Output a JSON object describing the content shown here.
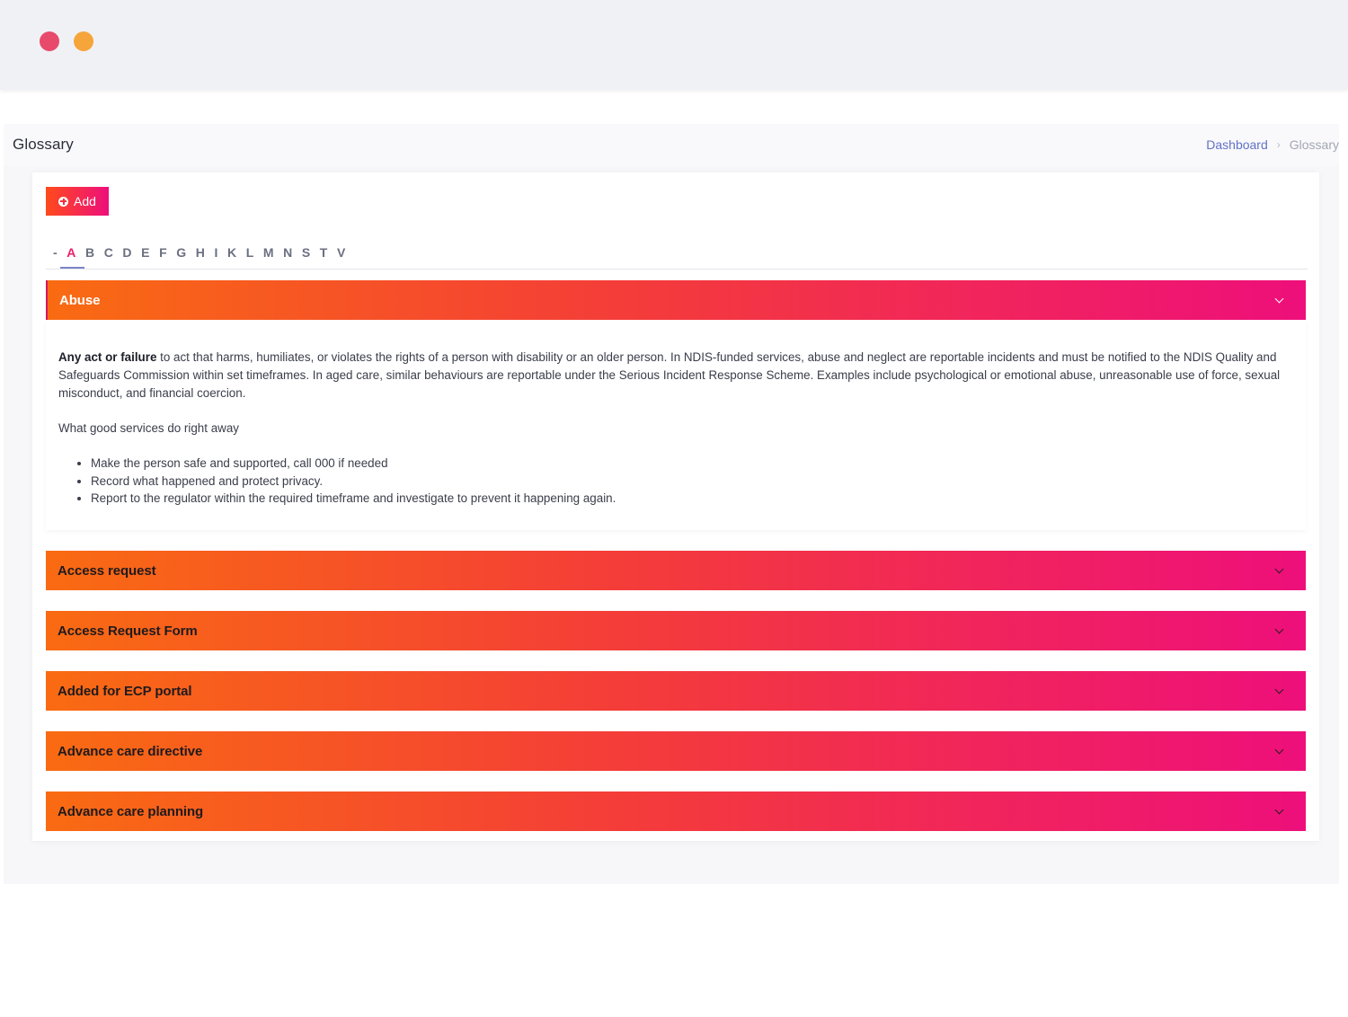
{
  "page": {
    "title": "Glossary",
    "breadcrumb": {
      "home": "Dashboard",
      "separator": "›",
      "current": "Glossary"
    }
  },
  "toolbar": {
    "add_label": "Add"
  },
  "letters": [
    "-",
    "A",
    "B",
    "C",
    "D",
    "E",
    "F",
    "G",
    "H",
    "I",
    "K",
    "L",
    "M",
    "N",
    "S",
    "T",
    "V"
  ],
  "active_letter": "A",
  "entries": [
    {
      "title": "Abuse",
      "expanded": true,
      "definition_bold": "Any act or failure",
      "definition_rest": " to act that harms, humiliates, or violates the rights of a person with disability or an older person. In NDIS-funded services, abuse and neglect are reportable incidents and must be notified to the NDIS Quality and Safeguards Commission within set timeframes. In aged care, similar behaviours are reportable under the Serious Incident Response Scheme. Examples include psychological or emotional abuse, unreasonable use of force, sexual misconduct, and financial coercion.",
      "subheading": "What good services do right away",
      "actions": [
        "Make the person safe and supported, call 000 if needed",
        "Record what happened and protect privacy.",
        "Report to the regulator within the required timeframe and investigate to prevent it happening again."
      ]
    },
    {
      "title": "Access request",
      "expanded": false
    },
    {
      "title": "Access Request Form",
      "expanded": false
    },
    {
      "title": "Added for ECP portal",
      "expanded": false
    },
    {
      "title": "Advance care directive",
      "expanded": false
    },
    {
      "title": "Advance care planning",
      "expanded": false
    }
  ],
  "colors": {
    "gradient_start": "#f96b12",
    "gradient_mid": "#f43d38",
    "gradient_end": "#ee0f7b",
    "accent_link": "#6271c6"
  }
}
